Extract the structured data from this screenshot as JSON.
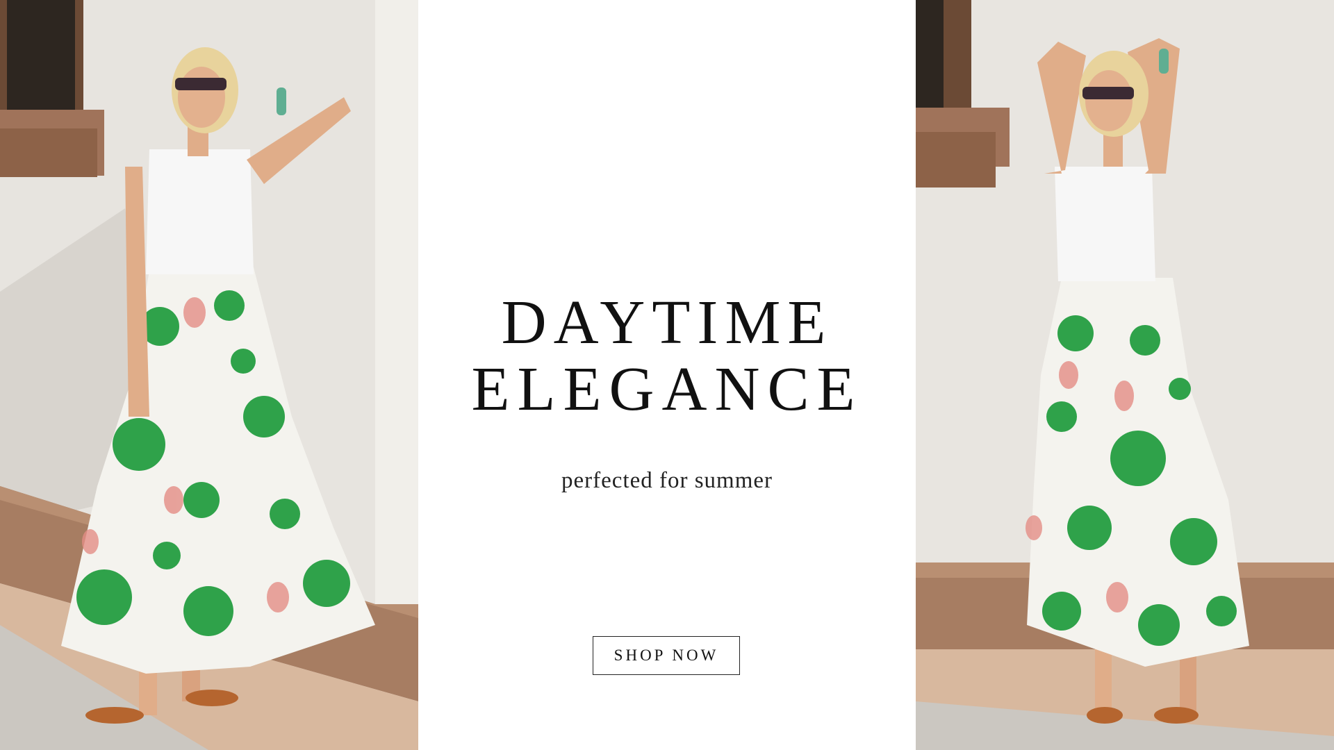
{
  "hero": {
    "headline_line1": "DAYTIME",
    "headline_line2": "ELEGANCE",
    "subheadline": "perfected for summer",
    "cta_label": "SHOP NOW"
  },
  "images": {
    "left_photo": "model in white tank top and green floral tiered maxi skirt leaning against wall",
    "right_photo": "model in white tank top and green floral tiered maxi skirt with arms raised"
  },
  "colors": {
    "wall": "#e6e3de",
    "ledge": "#a77d62",
    "skirt_green": "#2fa24a",
    "skirt_white": "#f4f3ee",
    "tank_top": "#f7f7f7",
    "skin": "#e3b18e",
    "hair": "#e8d39c"
  }
}
